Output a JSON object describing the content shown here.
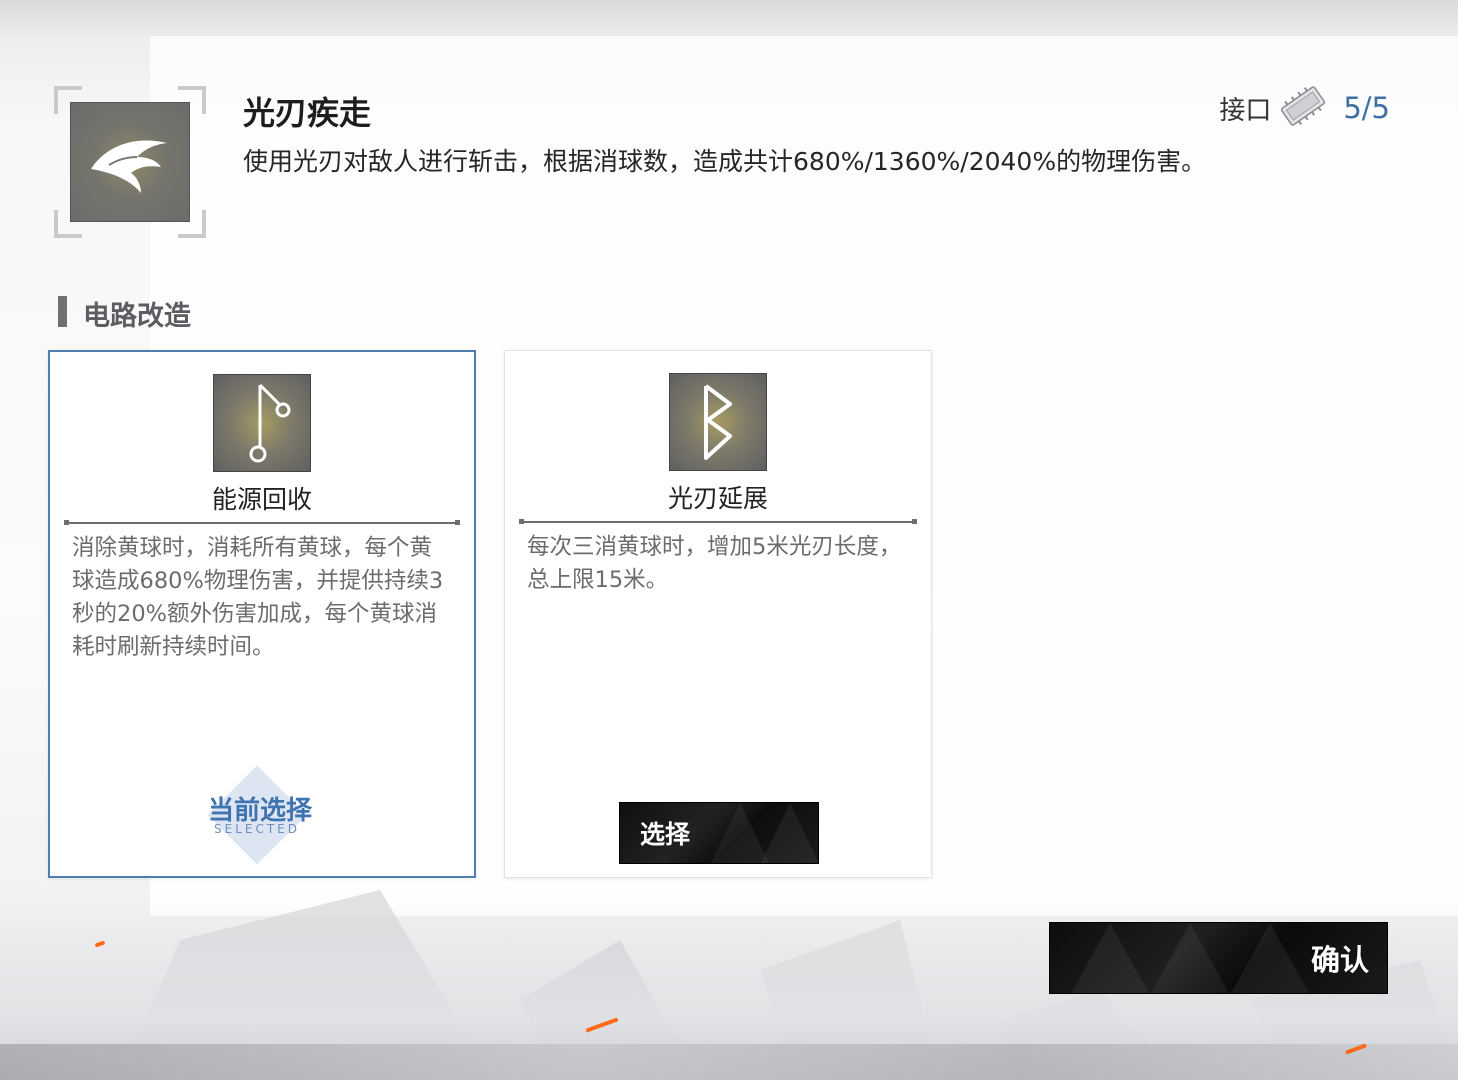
{
  "skill": {
    "name": "光刃疾走",
    "description": "使用光刃对敌人进行斩击，根据消球数，造成共计680%/1360%/2040%的物理伤害。",
    "icon": "blade-wing-icon"
  },
  "interface": {
    "label": "接口",
    "value": "5/5",
    "icon": "chip-icon"
  },
  "section": {
    "title": "电路改造"
  },
  "cards": [
    {
      "title": "能源回收",
      "description": "消除黄球时，消耗所有黄球，每个黄球造成680%物理伤害，并提供持续3秒的20%额外伤害加成，每个黄球消耗时刷新持续时间。",
      "icon": "circuit-node-icon",
      "selected": true,
      "selected_label": "当前选择",
      "selected_sub": "SELECTED"
    },
    {
      "title": "光刃延展",
      "description": "每次三消黄球时，增加5米光刃长度，总上限15米。",
      "icon": "rune-b-icon",
      "selected": false,
      "select_label": "选择"
    }
  ],
  "footer": {
    "confirm_label": "确认"
  }
}
